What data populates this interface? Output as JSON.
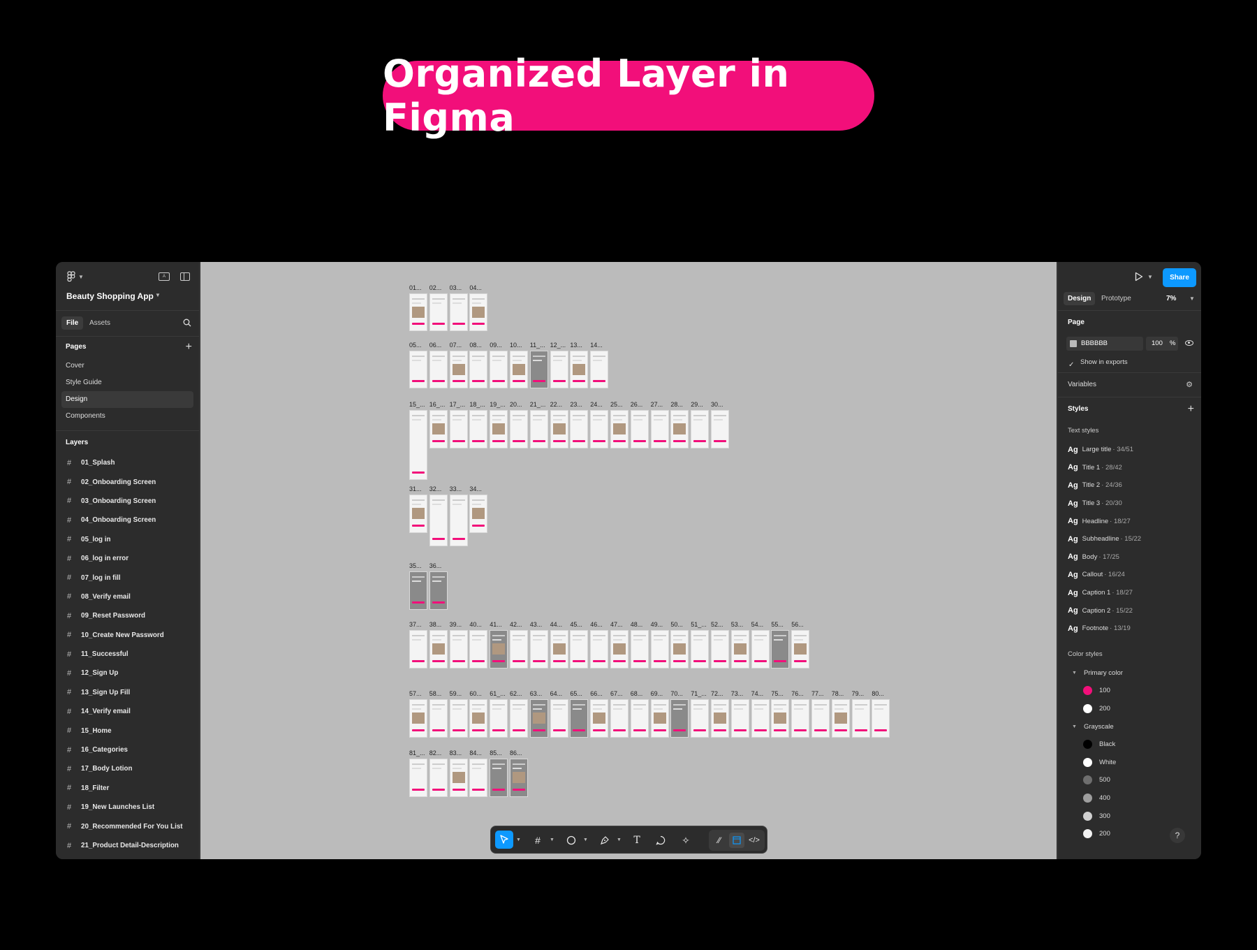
{
  "banner": {
    "text": "Organized Layer in Figma"
  },
  "left_panel": {
    "project_name": "Beauty Shopping App",
    "tabs": {
      "file": "File",
      "assets": "Assets"
    },
    "pages_title": "Pages",
    "pages": [
      {
        "label": "Cover",
        "active": false
      },
      {
        "label": "Style Guide",
        "active": false
      },
      {
        "label": "Design",
        "active": true
      },
      {
        "label": "Components",
        "active": false
      }
    ],
    "layers_title": "Layers",
    "layers": [
      "01_Splash",
      "02_Onboarding Screen",
      "03_Onboarding Screen",
      "04_Onboarding Screen",
      "05_log in",
      "06_log in error",
      "07_log in fill",
      "08_Verify email",
      "09_Reset Password",
      "10_Create New Password",
      "11_Successful",
      "12_Sign Up",
      "13_Sign Up Fill",
      "14_Verify email",
      "15_Home",
      "16_Categories",
      "17_Body Lotion",
      "18_Filter",
      "19_New Launches List",
      "20_Recommended For You List",
      "21_Product Detail-Description"
    ]
  },
  "canvas": {
    "background": "#BBBBBB",
    "rows": [
      [
        "01...",
        "02...",
        "03...",
        "04..."
      ],
      [
        "05...",
        "06...",
        "07...",
        "08...",
        "09...",
        "10...",
        "11_...",
        "12_...",
        "13...",
        "14..."
      ],
      [
        "15_...",
        "16_...",
        "17_...",
        "18_...",
        "19_...",
        "20...",
        "21_...",
        "22...",
        "23...",
        "24...",
        "25...",
        "26...",
        "27...",
        "28...",
        "29...",
        "30..."
      ],
      [
        "31...",
        "32...",
        "33...",
        "34..."
      ],
      [
        "35...",
        "36..."
      ],
      [
        "37...",
        "38...",
        "39...",
        "40...",
        "41...",
        "42...",
        "43...",
        "44...",
        "45...",
        "46...",
        "47...",
        "48...",
        "49...",
        "50...",
        "51_...",
        "52...",
        "53...",
        "54...",
        "55...",
        "56..."
      ],
      [
        "57...",
        "58...",
        "59...",
        "60...",
        "61_...",
        "62...",
        "63...",
        "64...",
        "65...",
        "66...",
        "67...",
        "68...",
        "69...",
        "70...",
        "71_...",
        "72...",
        "73...",
        "74...",
        "75...",
        "76...",
        "77...",
        "78...",
        "79...",
        "80..."
      ],
      [
        "81_...",
        "82...",
        "83...",
        "84...",
        "85...",
        "86..."
      ]
    ]
  },
  "toolbar": {
    "tools": [
      "move-tool",
      "frame-tool",
      "shape-tool",
      "pen-tool",
      "text-tool",
      "comment-tool",
      "actions-tool",
      "draw-mode",
      "design-mode",
      "dev-mode"
    ]
  },
  "right_panel": {
    "share_label": "Share",
    "tabs": {
      "design": "Design",
      "prototype": "Prototype"
    },
    "zoom": "7%",
    "page_title": "Page",
    "page_color": "BBBBBB",
    "page_opacity": "100",
    "page_opacity_unit": "%",
    "show_in_exports": "Show in exports",
    "variables_title": "Variables",
    "styles_title": "Styles",
    "text_styles_title": "Text styles",
    "text_styles": [
      {
        "name": "Large title",
        "size": "· 34/51"
      },
      {
        "name": "Title 1",
        "size": "· 28/42"
      },
      {
        "name": "Title 2",
        "size": "· 24/36"
      },
      {
        "name": "Title 3",
        "size": "· 20/30"
      },
      {
        "name": "Headline",
        "size": "· 18/27"
      },
      {
        "name": "Subheadline",
        "size": "· 15/22"
      },
      {
        "name": "Body",
        "size": "· 17/25"
      },
      {
        "name": "Callout",
        "size": "· 16/24"
      },
      {
        "name": "Caption 1",
        "size": "· 18/27"
      },
      {
        "name": "Caption 2",
        "size": "· 15/22"
      },
      {
        "name": "Footnote",
        "size": "· 13/19"
      }
    ],
    "ag_label": "Ag",
    "color_styles_title": "Color styles",
    "color_groups": [
      {
        "name": "Primary color",
        "items": [
          {
            "name": "100",
            "color": "#F20F7A"
          },
          {
            "name": "200",
            "color": "#FFFFFF"
          }
        ]
      },
      {
        "name": "Grayscale",
        "items": [
          {
            "name": "Black",
            "color": "#000000"
          },
          {
            "name": "White",
            "color": "#FFFFFF"
          },
          {
            "name": "500",
            "color": "#6E6E6E"
          },
          {
            "name": "400",
            "color": "#9E9E9E"
          },
          {
            "name": "300",
            "color": "#D0D0D0"
          },
          {
            "name": "200",
            "color": "#F2F2F2"
          }
        ]
      }
    ],
    "help": "?"
  },
  "colors": {
    "accent": "#F20F7A",
    "share_blue": "#0D99FF",
    "panel": "#2C2C2C"
  }
}
